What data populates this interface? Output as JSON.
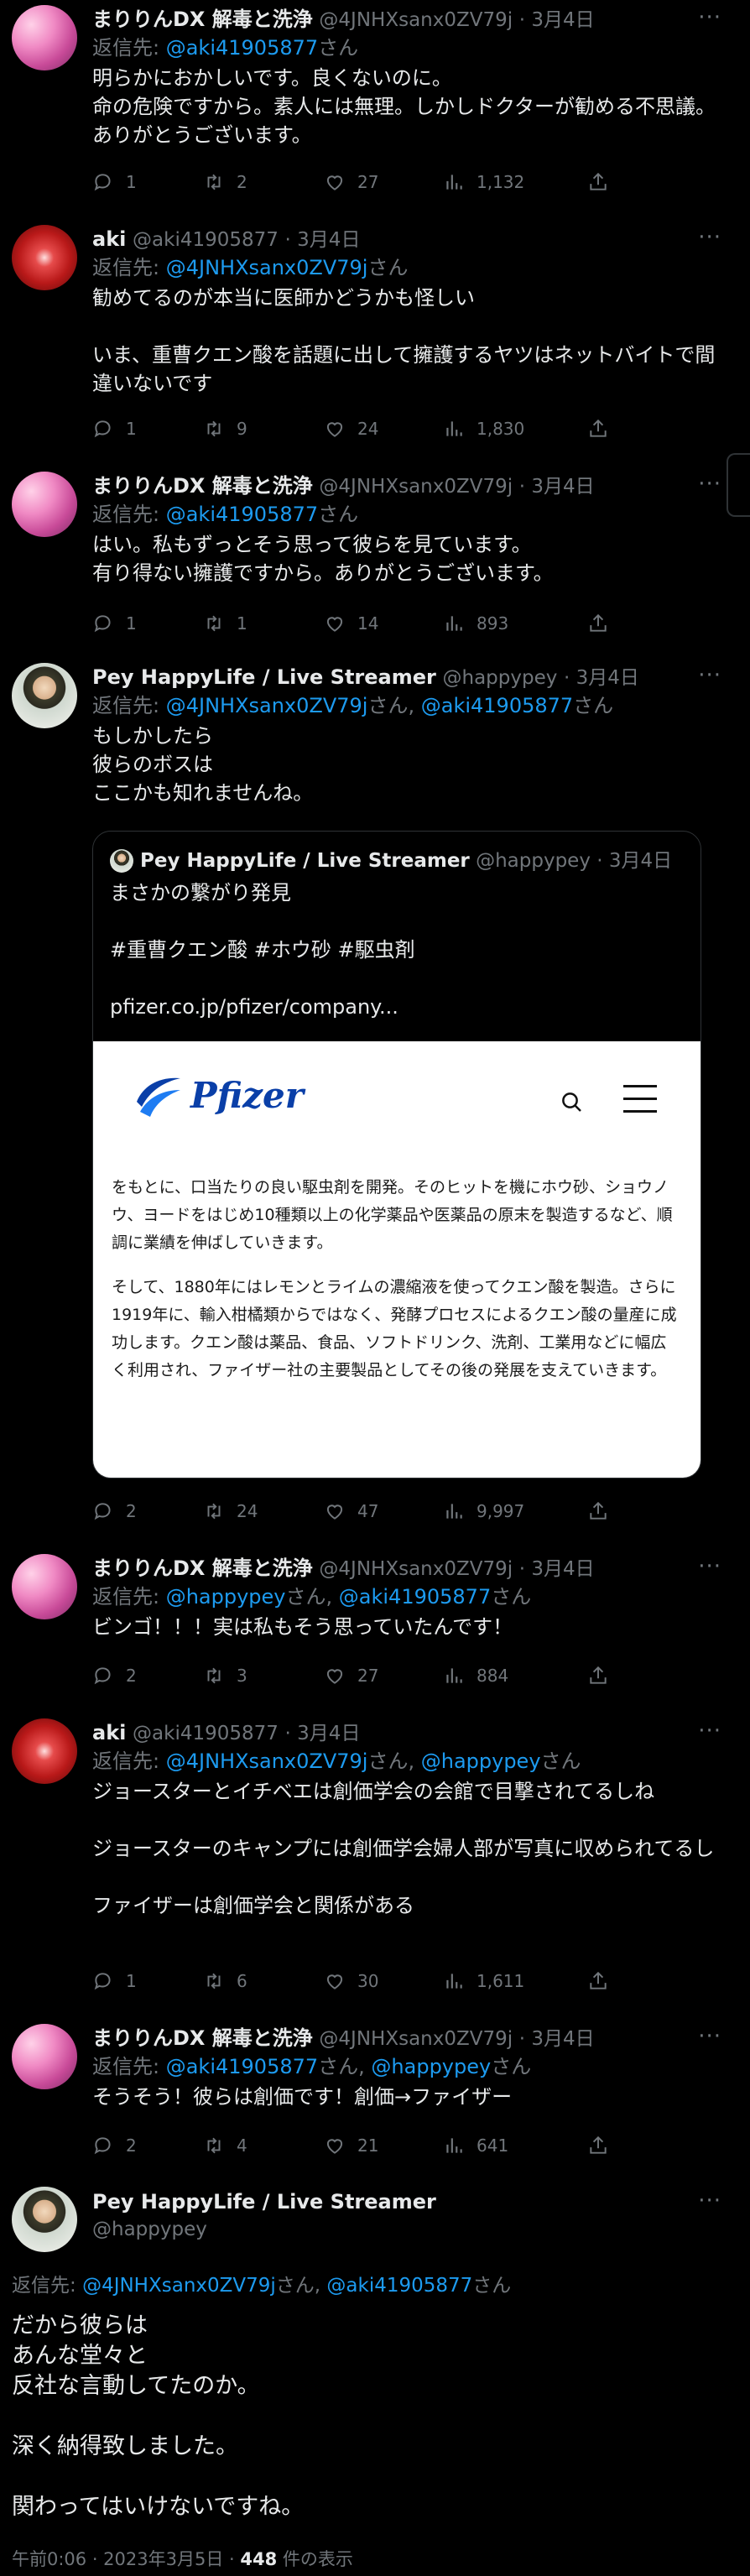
{
  "tweets": [
    {
      "name": "まりりんDX 解毒と洗浄",
      "handle": "@4JNHXsanx0ZV79j",
      "date": "3月4日",
      "reply_prefix": "返信先: ",
      "reply_mentions": [
        "@aki41905877"
      ],
      "reply_suffix": "さん",
      "text": "明らかにおかしいです。良くないのに。\n命の危険ですから。素人には無理。しかしドクターが勧める不思議。ありがとうございます。",
      "replies": "1",
      "retweets": "2",
      "likes": "27",
      "views": "1,132"
    },
    {
      "name": "aki",
      "handle": "@aki41905877",
      "date": "3月4日",
      "reply_prefix": "返信先: ",
      "reply_mentions": [
        "@4JNHXsanx0ZV79j"
      ],
      "reply_suffix": "さん",
      "text": "勧めてるのが本当に医師かどうかも怪しい\n\nいま、重曹クエン酸を話題に出して擁護するヤツはネットバイトで間違いないです",
      "replies": "1",
      "retweets": "9",
      "likes": "24",
      "views": "1,830"
    },
    {
      "name": "まりりんDX 解毒と洗浄",
      "handle": "@4JNHXsanx0ZV79j",
      "date": "3月4日",
      "reply_prefix": "返信先: ",
      "reply_mentions": [
        "@aki41905877"
      ],
      "reply_suffix": "さん",
      "text": "はい。私もずっとそう思って彼らを見ています。\n有り得ない擁護ですから。ありがとうございます。",
      "replies": "1",
      "retweets": "1",
      "likes": "14",
      "views": "893"
    },
    {
      "name": "Pey HappyLife / Live Streamer",
      "handle": "@happypey",
      "date": "3月4日",
      "reply_prefix": "返信先: ",
      "reply_mentions": [
        "@4JNHXsanx0ZV79j",
        "@aki41905877"
      ],
      "reply_suffix": "さん",
      "text": "もしかしたら\n彼らのボスは\nここかも知れませんね。",
      "replies": "2",
      "retweets": "24",
      "likes": "47",
      "views": "9,997",
      "quote": {
        "name": "Pey HappyLife / Live Streamer",
        "handle": "@happypey",
        "date": "3月4日",
        "text": "まさかの繋がり発見\n\n#重曹クエン酸 #ホウ砂 #駆虫剤\n\npfizer.co.jp/pfizer/company...",
        "image_logo": "Pfizer",
        "image_para1": "をもとに、口当たりの良い駆虫剤を開発。そのヒットを機にホウ砂、ショウノウ、ヨードをはじめ10種類以上の化学薬品や医薬品の原末を製造するなど、順調に業績を伸ばしていきます。",
        "image_para2": "そして、1880年にはレモンとライムの濃縮液を使ってクエン酸を製造。さらに1919年に、輸入柑橘類からではなく、発酵プロセスによるクエン酸の量産に成功します。クエン酸は薬品、食品、ソフトドリンク、洗剤、工業用などに幅広く利用され、ファイザー社の主要製品としてその後の発展を支えていきます。"
      }
    },
    {
      "name": "まりりんDX 解毒と洗浄",
      "handle": "@4JNHXsanx0ZV79j",
      "date": "3月4日",
      "reply_prefix": "返信先: ",
      "reply_mentions": [
        "@happypey",
        "@aki41905877"
      ],
      "reply_suffix": "さん",
      "text": "ビンゴ！！！実は私もそう思っていたんです！",
      "replies": "2",
      "retweets": "3",
      "likes": "27",
      "views": "884"
    },
    {
      "name": "aki",
      "handle": "@aki41905877",
      "date": "3月4日",
      "reply_prefix": "返信先: ",
      "reply_mentions": [
        "@4JNHXsanx0ZV79j",
        "@happypey"
      ],
      "reply_suffix": "さん",
      "text": "ジョースターとイチベエは創価学会の会館で目撃されてるしね\n\nジョースターのキャンプには創価学会婦人部が写真に収められてるし\n\nファイザーは創価学会と関係がある",
      "replies": "1",
      "retweets": "6",
      "likes": "30",
      "views": "1,611"
    },
    {
      "name": "まりりんDX 解毒と洗浄",
      "handle": "@4JNHXsanx0ZV79j",
      "date": "3月4日",
      "reply_prefix": "返信先: ",
      "reply_mentions": [
        "@aki41905877",
        "@happypey"
      ],
      "reply_suffix": "さん",
      "text": "そうそう！彼らは創価です！創価→ファイザー",
      "replies": "2",
      "retweets": "4",
      "likes": "21",
      "views": "641"
    }
  ],
  "focus": {
    "name": "Pey HappyLife / Live Streamer",
    "handle": "@happypey",
    "reply_prefix": "返信先: ",
    "reply_mentions": [
      "@4JNHXsanx0ZV79j",
      "@aki41905877"
    ],
    "reply_suffix": "さん",
    "text": "だから彼らは\nあんな堂々と\n反社な言動してたのか。\n\n深く納得致しました。\n\n関わってはいけないですね。",
    "time": "午前0:06 · 2023年3月5日 · ",
    "views_count": "448",
    "views_label": " 件の表示"
  },
  "ui": {
    "more": "···",
    "separator": " · "
  }
}
